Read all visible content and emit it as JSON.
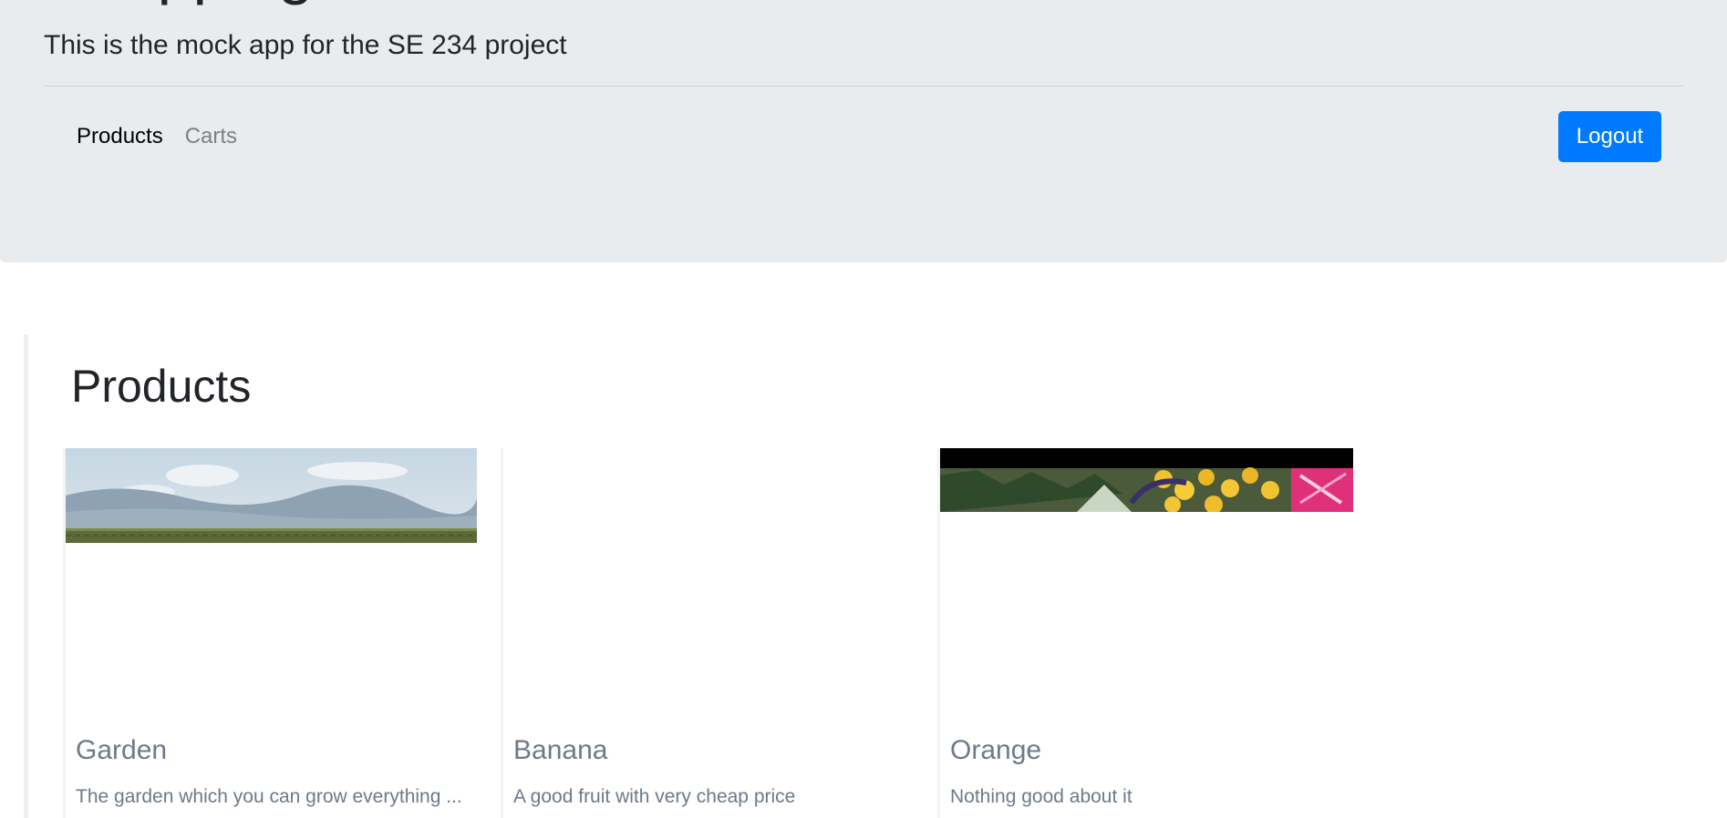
{
  "header": {
    "title": "Shopping",
    "lead": "This is the mock app for the SE 234 project",
    "nav": [
      {
        "label": "Products",
        "active": true
      },
      {
        "label": "Carts",
        "active": false
      }
    ],
    "logout_label": "Logout"
  },
  "main": {
    "title": "Products",
    "products": [
      {
        "name": "Garden",
        "description": "The garden which you can grow everything ..."
      },
      {
        "name": "Banana",
        "description": "A good fruit with very cheap price"
      },
      {
        "name": "Orange",
        "description": "Nothing good about it"
      }
    ]
  },
  "colors": {
    "jumbotron_bg": "#e9ecef",
    "primary": "#007bff",
    "card_text": "#6c7a8a"
  }
}
